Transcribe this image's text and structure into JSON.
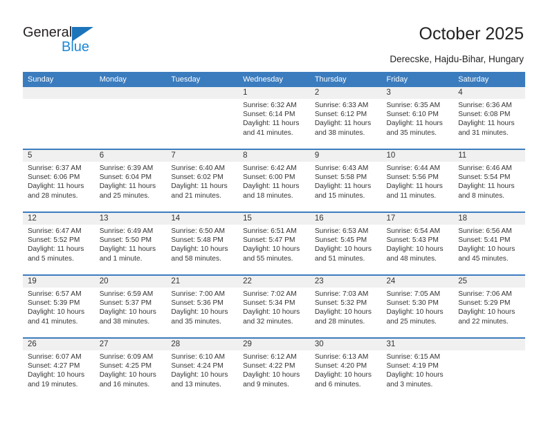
{
  "brand": {
    "name_part1": "General",
    "name_part2": "Blue",
    "triangle_icon": "triangle-icon",
    "accent_color": "#1c74bb",
    "blue_text_color": "#1c86d4"
  },
  "header": {
    "title": "October 2025",
    "subtitle": "Derecske, Hajdu-Bihar, Hungary"
  },
  "theme": {
    "header_row_color": "#3b7cbe",
    "daynum_band_color": "#f0f0f0",
    "text_color": "#333333"
  },
  "weekday_headers": [
    "Sunday",
    "Monday",
    "Tuesday",
    "Wednesday",
    "Thursday",
    "Friday",
    "Saturday"
  ],
  "weeks": [
    [
      {
        "day": "",
        "empty": true,
        "sunrise": "",
        "sunset": "",
        "daylight_line1": "",
        "daylight_line2": ""
      },
      {
        "day": "",
        "empty": true,
        "sunrise": "",
        "sunset": "",
        "daylight_line1": "",
        "daylight_line2": ""
      },
      {
        "day": "",
        "empty": true,
        "sunrise": "",
        "sunset": "",
        "daylight_line1": "",
        "daylight_line2": ""
      },
      {
        "day": "1",
        "empty": false,
        "sunrise": "Sunrise: 6:32 AM",
        "sunset": "Sunset: 6:14 PM",
        "daylight_line1": "Daylight: 11 hours",
        "daylight_line2": "and 41 minutes."
      },
      {
        "day": "2",
        "empty": false,
        "sunrise": "Sunrise: 6:33 AM",
        "sunset": "Sunset: 6:12 PM",
        "daylight_line1": "Daylight: 11 hours",
        "daylight_line2": "and 38 minutes."
      },
      {
        "day": "3",
        "empty": false,
        "sunrise": "Sunrise: 6:35 AM",
        "sunset": "Sunset: 6:10 PM",
        "daylight_line1": "Daylight: 11 hours",
        "daylight_line2": "and 35 minutes."
      },
      {
        "day": "4",
        "empty": false,
        "sunrise": "Sunrise: 6:36 AM",
        "sunset": "Sunset: 6:08 PM",
        "daylight_line1": "Daylight: 11 hours",
        "daylight_line2": "and 31 minutes."
      }
    ],
    [
      {
        "day": "5",
        "empty": false,
        "sunrise": "Sunrise: 6:37 AM",
        "sunset": "Sunset: 6:06 PM",
        "daylight_line1": "Daylight: 11 hours",
        "daylight_line2": "and 28 minutes."
      },
      {
        "day": "6",
        "empty": false,
        "sunrise": "Sunrise: 6:39 AM",
        "sunset": "Sunset: 6:04 PM",
        "daylight_line1": "Daylight: 11 hours",
        "daylight_line2": "and 25 minutes."
      },
      {
        "day": "7",
        "empty": false,
        "sunrise": "Sunrise: 6:40 AM",
        "sunset": "Sunset: 6:02 PM",
        "daylight_line1": "Daylight: 11 hours",
        "daylight_line2": "and 21 minutes."
      },
      {
        "day": "8",
        "empty": false,
        "sunrise": "Sunrise: 6:42 AM",
        "sunset": "Sunset: 6:00 PM",
        "daylight_line1": "Daylight: 11 hours",
        "daylight_line2": "and 18 minutes."
      },
      {
        "day": "9",
        "empty": false,
        "sunrise": "Sunrise: 6:43 AM",
        "sunset": "Sunset: 5:58 PM",
        "daylight_line1": "Daylight: 11 hours",
        "daylight_line2": "and 15 minutes."
      },
      {
        "day": "10",
        "empty": false,
        "sunrise": "Sunrise: 6:44 AM",
        "sunset": "Sunset: 5:56 PM",
        "daylight_line1": "Daylight: 11 hours",
        "daylight_line2": "and 11 minutes."
      },
      {
        "day": "11",
        "empty": false,
        "sunrise": "Sunrise: 6:46 AM",
        "sunset": "Sunset: 5:54 PM",
        "daylight_line1": "Daylight: 11 hours",
        "daylight_line2": "and 8 minutes."
      }
    ],
    [
      {
        "day": "12",
        "empty": false,
        "sunrise": "Sunrise: 6:47 AM",
        "sunset": "Sunset: 5:52 PM",
        "daylight_line1": "Daylight: 11 hours",
        "daylight_line2": "and 5 minutes."
      },
      {
        "day": "13",
        "empty": false,
        "sunrise": "Sunrise: 6:49 AM",
        "sunset": "Sunset: 5:50 PM",
        "daylight_line1": "Daylight: 11 hours",
        "daylight_line2": "and 1 minute."
      },
      {
        "day": "14",
        "empty": false,
        "sunrise": "Sunrise: 6:50 AM",
        "sunset": "Sunset: 5:48 PM",
        "daylight_line1": "Daylight: 10 hours",
        "daylight_line2": "and 58 minutes."
      },
      {
        "day": "15",
        "empty": false,
        "sunrise": "Sunrise: 6:51 AM",
        "sunset": "Sunset: 5:47 PM",
        "daylight_line1": "Daylight: 10 hours",
        "daylight_line2": "and 55 minutes."
      },
      {
        "day": "16",
        "empty": false,
        "sunrise": "Sunrise: 6:53 AM",
        "sunset": "Sunset: 5:45 PM",
        "daylight_line1": "Daylight: 10 hours",
        "daylight_line2": "and 51 minutes."
      },
      {
        "day": "17",
        "empty": false,
        "sunrise": "Sunrise: 6:54 AM",
        "sunset": "Sunset: 5:43 PM",
        "daylight_line1": "Daylight: 10 hours",
        "daylight_line2": "and 48 minutes."
      },
      {
        "day": "18",
        "empty": false,
        "sunrise": "Sunrise: 6:56 AM",
        "sunset": "Sunset: 5:41 PM",
        "daylight_line1": "Daylight: 10 hours",
        "daylight_line2": "and 45 minutes."
      }
    ],
    [
      {
        "day": "19",
        "empty": false,
        "sunrise": "Sunrise: 6:57 AM",
        "sunset": "Sunset: 5:39 PM",
        "daylight_line1": "Daylight: 10 hours",
        "daylight_line2": "and 41 minutes."
      },
      {
        "day": "20",
        "empty": false,
        "sunrise": "Sunrise: 6:59 AM",
        "sunset": "Sunset: 5:37 PM",
        "daylight_line1": "Daylight: 10 hours",
        "daylight_line2": "and 38 minutes."
      },
      {
        "day": "21",
        "empty": false,
        "sunrise": "Sunrise: 7:00 AM",
        "sunset": "Sunset: 5:36 PM",
        "daylight_line1": "Daylight: 10 hours",
        "daylight_line2": "and 35 minutes."
      },
      {
        "day": "22",
        "empty": false,
        "sunrise": "Sunrise: 7:02 AM",
        "sunset": "Sunset: 5:34 PM",
        "daylight_line1": "Daylight: 10 hours",
        "daylight_line2": "and 32 minutes."
      },
      {
        "day": "23",
        "empty": false,
        "sunrise": "Sunrise: 7:03 AM",
        "sunset": "Sunset: 5:32 PM",
        "daylight_line1": "Daylight: 10 hours",
        "daylight_line2": "and 28 minutes."
      },
      {
        "day": "24",
        "empty": false,
        "sunrise": "Sunrise: 7:05 AM",
        "sunset": "Sunset: 5:30 PM",
        "daylight_line1": "Daylight: 10 hours",
        "daylight_line2": "and 25 minutes."
      },
      {
        "day": "25",
        "empty": false,
        "sunrise": "Sunrise: 7:06 AM",
        "sunset": "Sunset: 5:29 PM",
        "daylight_line1": "Daylight: 10 hours",
        "daylight_line2": "and 22 minutes."
      }
    ],
    [
      {
        "day": "26",
        "empty": false,
        "sunrise": "Sunrise: 6:07 AM",
        "sunset": "Sunset: 4:27 PM",
        "daylight_line1": "Daylight: 10 hours",
        "daylight_line2": "and 19 minutes."
      },
      {
        "day": "27",
        "empty": false,
        "sunrise": "Sunrise: 6:09 AM",
        "sunset": "Sunset: 4:25 PM",
        "daylight_line1": "Daylight: 10 hours",
        "daylight_line2": "and 16 minutes."
      },
      {
        "day": "28",
        "empty": false,
        "sunrise": "Sunrise: 6:10 AM",
        "sunset": "Sunset: 4:24 PM",
        "daylight_line1": "Daylight: 10 hours",
        "daylight_line2": "and 13 minutes."
      },
      {
        "day": "29",
        "empty": false,
        "sunrise": "Sunrise: 6:12 AM",
        "sunset": "Sunset: 4:22 PM",
        "daylight_line1": "Daylight: 10 hours",
        "daylight_line2": "and 9 minutes."
      },
      {
        "day": "30",
        "empty": false,
        "sunrise": "Sunrise: 6:13 AM",
        "sunset": "Sunset: 4:20 PM",
        "daylight_line1": "Daylight: 10 hours",
        "daylight_line2": "and 6 minutes."
      },
      {
        "day": "31",
        "empty": false,
        "sunrise": "Sunrise: 6:15 AM",
        "sunset": "Sunset: 4:19 PM",
        "daylight_line1": "Daylight: 10 hours",
        "daylight_line2": "and 3 minutes."
      },
      {
        "day": "",
        "empty": true,
        "sunrise": "",
        "sunset": "",
        "daylight_line1": "",
        "daylight_line2": ""
      }
    ]
  ]
}
